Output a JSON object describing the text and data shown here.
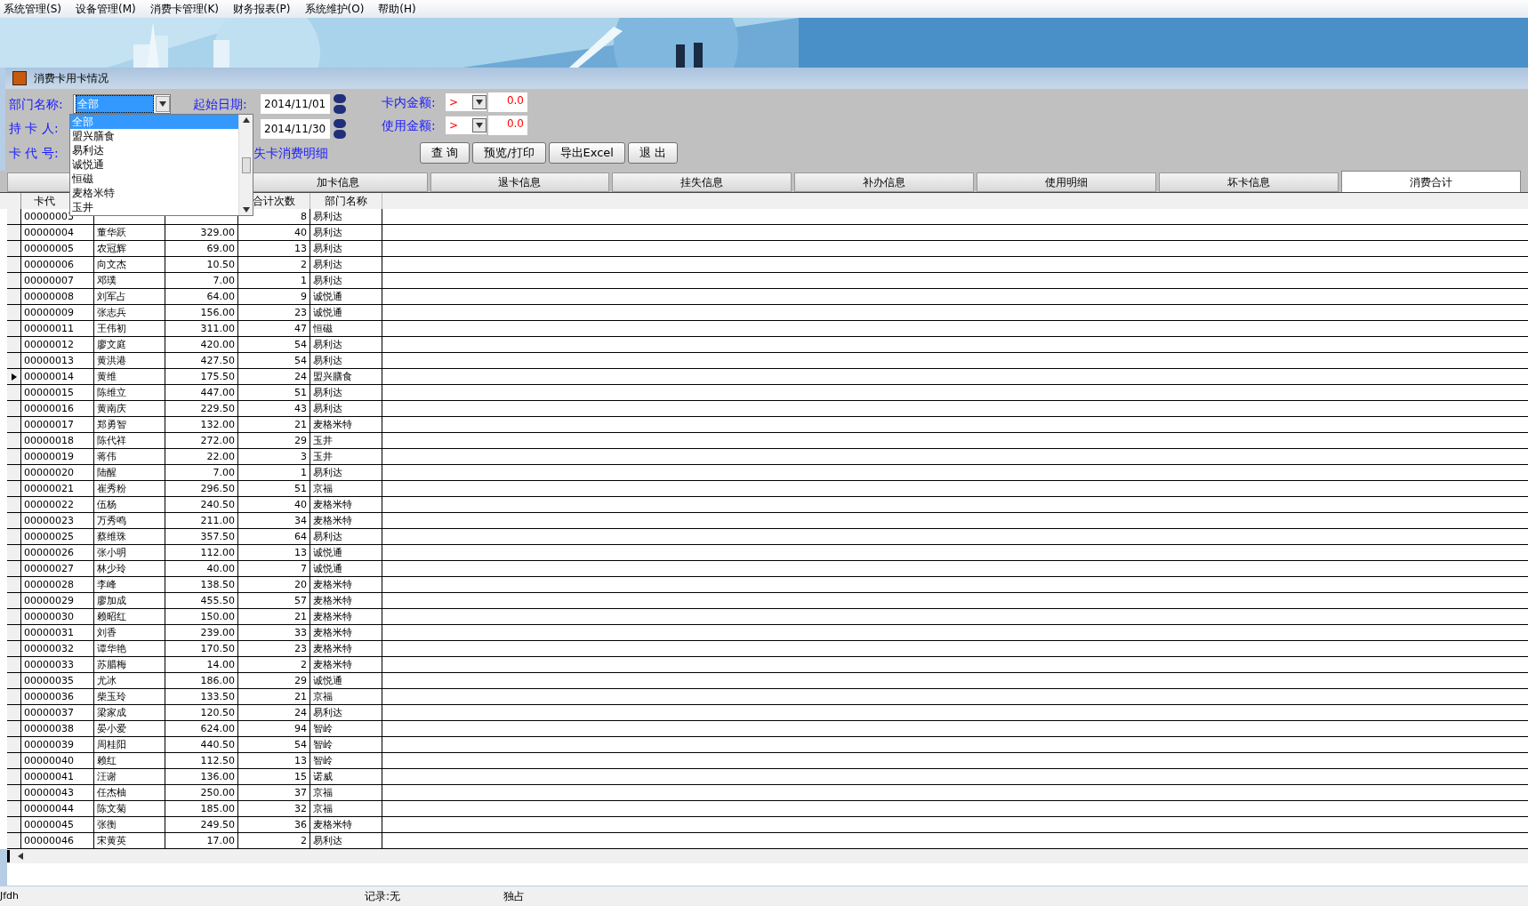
{
  "menu": [
    "系统管理(S)",
    "设备管理(M)",
    "消费卡管理(K)",
    "财务报表(P)",
    "系统维护(O)",
    "帮助(H)"
  ],
  "window": {
    "title": "消费卡用卡情况"
  },
  "form": {
    "dept_label": "部门名称:",
    "dept_value": "全部",
    "holder_label": "持 卡 人:",
    "card_label": "卡 代 号:",
    "start_label": "起始日期:",
    "start_date": "2014/11/01",
    "end_date": "2014/11/30",
    "balance_label": "卡内金额:",
    "balance_op": ">",
    "balance_value": "0.0",
    "used_label": "使用金额:",
    "used_op": ">",
    "used_value": "0.0",
    "link": "失卡消费明细"
  },
  "buttons": [
    "查 询",
    "预览/打印",
    "导出Excel",
    "退 出"
  ],
  "tabs": [
    {
      "selected": false
    },
    {
      "label": "加卡信息",
      "selected": false
    },
    {
      "label": "退卡信息",
      "selected": false
    },
    {
      "label": "挂失信息",
      "selected": false
    },
    {
      "label": "补办信息",
      "selected": false
    },
    {
      "label": "使用明细",
      "selected": false
    },
    {
      "label": "坏卡信息",
      "selected": false
    },
    {
      "label": "消费合计",
      "selected": true
    }
  ],
  "dropdown": {
    "items": [
      {
        "label": "全部",
        "selected": true
      },
      {
        "label": "盟兴膳食",
        "selected": false
      },
      {
        "label": "易利达",
        "selected": false
      },
      {
        "label": "诚悦通",
        "selected": false
      },
      {
        "label": "恒磁",
        "selected": false
      },
      {
        "label": "麦格米特",
        "selected": false
      },
      {
        "label": "玉井",
        "selected": false
      }
    ]
  },
  "table": {
    "columns": [
      {
        "label": "卡代"
      },
      {},
      {},
      {
        "label": "合计次数"
      },
      {
        "label": "部门名称"
      }
    ],
    "rows": [
      {
        "cells": [
          "00000003",
          null,
          null,
          "8",
          "易利达"
        ],
        "selected": false
      },
      {
        "cells": [
          "00000004",
          "董华跃",
          "329.00",
          "40",
          "易利达"
        ],
        "selected": false
      },
      {
        "cells": [
          "00000005",
          "农冠辉",
          "69.00",
          "13",
          "易利达"
        ],
        "selected": false
      },
      {
        "cells": [
          "00000006",
          "向文杰",
          "10.50",
          "2",
          "易利达"
        ],
        "selected": false
      },
      {
        "cells": [
          "00000007",
          "邓璞",
          "7.00",
          "1",
          "易利达"
        ],
        "selected": false
      },
      {
        "cells": [
          "00000008",
          "刘军占",
          "64.00",
          "9",
          "诚悦通"
        ],
        "selected": false
      },
      {
        "cells": [
          "00000009",
          "张志兵",
          "156.00",
          "23",
          "诚悦通"
        ],
        "selected": false
      },
      {
        "cells": [
          "00000011",
          "王伟初",
          "311.00",
          "47",
          "恒磁"
        ],
        "selected": false
      },
      {
        "cells": [
          "00000012",
          "廖文庭",
          "420.00",
          "54",
          "易利达"
        ],
        "selected": false
      },
      {
        "cells": [
          "00000013",
          "黄洪港",
          "427.50",
          "54",
          "易利达"
        ],
        "selected": false
      },
      {
        "cells": [
          "00000014",
          "黄维",
          "175.50",
          "24",
          "盟兴膳食"
        ],
        "selected": true
      },
      {
        "cells": [
          "00000015",
          "陈维立",
          "447.00",
          "51",
          "易利达"
        ],
        "selected": false
      },
      {
        "cells": [
          "00000016",
          "黄南庆",
          "229.50",
          "43",
          "易利达"
        ],
        "selected": false
      },
      {
        "cells": [
          "00000017",
          "郑勇智",
          "132.00",
          "21",
          "麦格米特"
        ],
        "selected": false
      },
      {
        "cells": [
          "00000018",
          "陈代祥",
          "272.00",
          "29",
          "玉井"
        ],
        "selected": false
      },
      {
        "cells": [
          "00000019",
          "蒋伟",
          "22.00",
          "3",
          "玉井"
        ],
        "selected": false
      },
      {
        "cells": [
          "00000020",
          "陆醒",
          "7.00",
          "1",
          "易利达"
        ],
        "selected": false
      },
      {
        "cells": [
          "00000021",
          "崔秀粉",
          "296.50",
          "51",
          "京福"
        ],
        "selected": false
      },
      {
        "cells": [
          "00000022",
          "伍杨",
          "240.50",
          "40",
          "麦格米特"
        ],
        "selected": false
      },
      {
        "cells": [
          "00000023",
          "万秀鸣",
          "211.00",
          "34",
          "麦格米特"
        ],
        "selected": false
      },
      {
        "cells": [
          "00000025",
          "蔡维珠",
          "357.50",
          "64",
          "易利达"
        ],
        "selected": false
      },
      {
        "cells": [
          "00000026",
          "张小明",
          "112.00",
          "13",
          "诚悦通"
        ],
        "selected": false
      },
      {
        "cells": [
          "00000027",
          "林少玲",
          "40.00",
          "7",
          "诚悦通"
        ],
        "selected": false
      },
      {
        "cells": [
          "00000028",
          "李峰",
          "138.50",
          "20",
          "麦格米特"
        ],
        "selected": false
      },
      {
        "cells": [
          "00000029",
          "廖加成",
          "455.50",
          "57",
          "麦格米特"
        ],
        "selected": false
      },
      {
        "cells": [
          "00000030",
          "赖昭红",
          "150.00",
          "21",
          "麦格米特"
        ],
        "selected": false
      },
      {
        "cells": [
          "00000031",
          "刘香",
          "239.00",
          "33",
          "麦格米特"
        ],
        "selected": false
      },
      {
        "cells": [
          "00000032",
          "谭华艳",
          "170.50",
          "23",
          "麦格米特"
        ],
        "selected": false
      },
      {
        "cells": [
          "00000033",
          "苏腊梅",
          "14.00",
          "2",
          "麦格米特"
        ],
        "selected": false
      },
      {
        "cells": [
          "00000035",
          "尤冰",
          "186.00",
          "29",
          "诚悦通"
        ],
        "selected": false
      },
      {
        "cells": [
          "00000036",
          "柴玉玲",
          "133.50",
          "21",
          "京福"
        ],
        "selected": false
      },
      {
        "cells": [
          "00000037",
          "梁家成",
          "120.50",
          "24",
          "易利达"
        ],
        "selected": false
      },
      {
        "cells": [
          "00000038",
          "晏小爱",
          "624.00",
          "94",
          "智岭"
        ],
        "selected": false
      },
      {
        "cells": [
          "00000039",
          "周桂阳",
          "440.50",
          "54",
          "智岭"
        ],
        "selected": false
      },
      {
        "cells": [
          "00000040",
          "赖红",
          "112.50",
          "13",
          "智岭"
        ],
        "selected": false
      },
      {
        "cells": [
          "00000041",
          "汪谢",
          "136.00",
          "15",
          "诺威"
        ],
        "selected": false
      },
      {
        "cells": [
          "00000043",
          "任杰柚",
          "250.00",
          "37",
          "京福"
        ],
        "selected": false
      },
      {
        "cells": [
          "00000044",
          "陈文菊",
          "185.00",
          "32",
          "京福"
        ],
        "selected": false
      },
      {
        "cells": [
          "00000045",
          "张衡",
          "249.50",
          "36",
          "麦格米特"
        ],
        "selected": false
      },
      {
        "cells": [
          "00000046",
          "宋黄英",
          "17.00",
          "2",
          "易利达"
        ],
        "selected": false
      }
    ]
  },
  "status_bar": [
    "Jfdh",
    "记录:无",
    "独占"
  ]
}
